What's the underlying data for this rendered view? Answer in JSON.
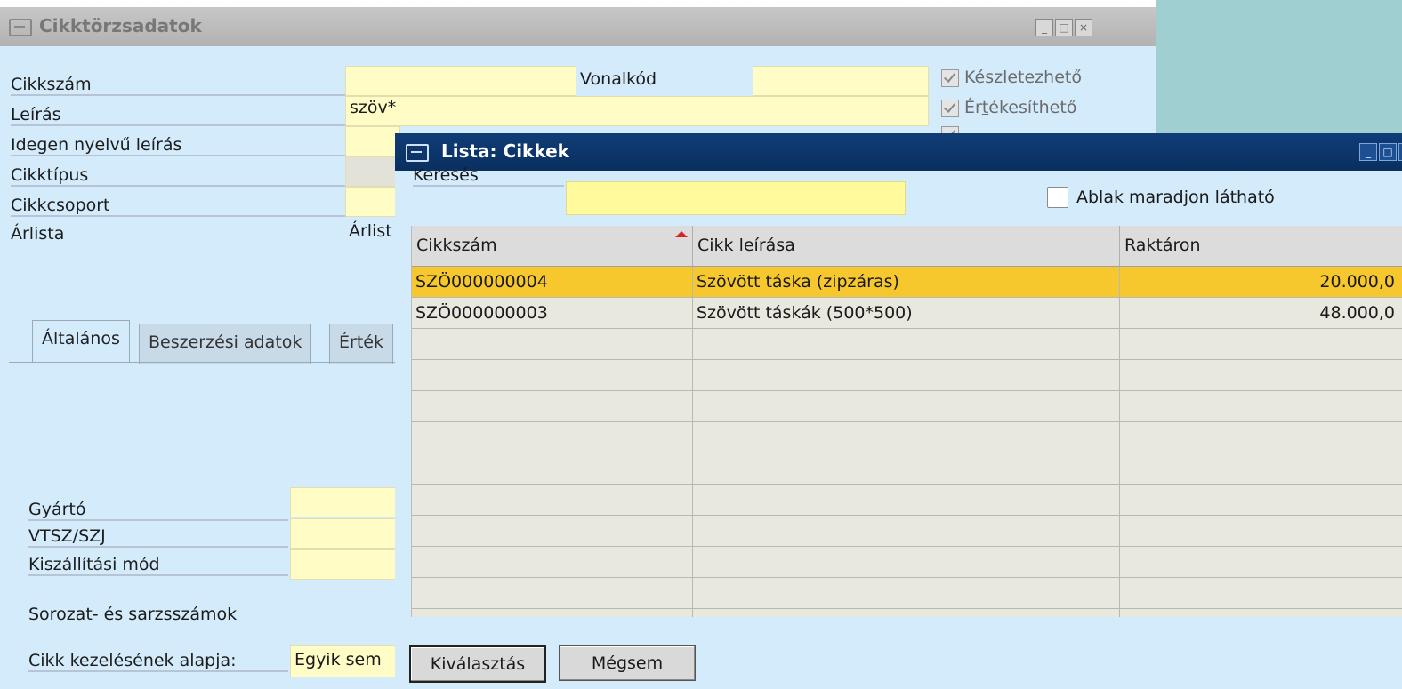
{
  "main_window": {
    "title": "Cikktörzsadatok",
    "fields": {
      "cikkszam_label": "Cikkszám",
      "vonalkod_label": "Vonalkód",
      "leiras_label": "Leírás",
      "leiras_value": "szöv*",
      "idegen_label": "Idegen nyelvű leírás",
      "cikktipus_label": "Cikktípus",
      "cikkcsoport_label": "Cikkcsoport",
      "arlista_label": "Árlista",
      "arlista_value": "Árlist"
    },
    "checkboxes": {
      "keszletezheto_first": "K",
      "keszletezheto_rest": "észletezhető",
      "ertekesitheto_first": "Ér",
      "ertekesitheto_u": "t",
      "ertekesitheto_rest": "ékesíthető"
    },
    "tabs": {
      "altalanos_a": "Általános",
      "beszerzesi": "Beszerzési adatok",
      "ertek": "Érték"
    },
    "lower": {
      "gyarto_label": "Gyártó",
      "vtsz_label": "VTSZ/SZJ",
      "kiszallitasi_label": "Kiszállítási mód",
      "sorozat_link": "Sorozat- és sarzsszámok",
      "kezeles_label": "Cikk kezelésének alapja:",
      "kezeles_value": "Egyik sem"
    }
  },
  "dialog": {
    "title": "Lista: Cikkek",
    "search_label": "Keresés",
    "search_value": "",
    "stay_visible_label": "Ablak maradjon látható",
    "stay_visible_checked": false,
    "columns": [
      "Cikkszám",
      "Cikk leírása",
      "Raktáron"
    ],
    "rows": [
      {
        "cikkszam": "SZÖ000000004",
        "leiras": "Szövött táska (zipzáras)",
        "raktaron": "20.000,0",
        "selected": true
      },
      {
        "cikkszam": "SZÖ000000003",
        "leiras": "Szövött táskák (500*500)",
        "raktaron": "48.000,0",
        "selected": false
      }
    ],
    "select_button": "Kiválasztás",
    "cancel_button": "Mégsem"
  },
  "colors": {
    "selected_row": "#f6c82e",
    "field_yellow": "#fffcc6",
    "dialog_titlebar": "#0f3d78",
    "panel_bg": "#d4ebfb"
  }
}
